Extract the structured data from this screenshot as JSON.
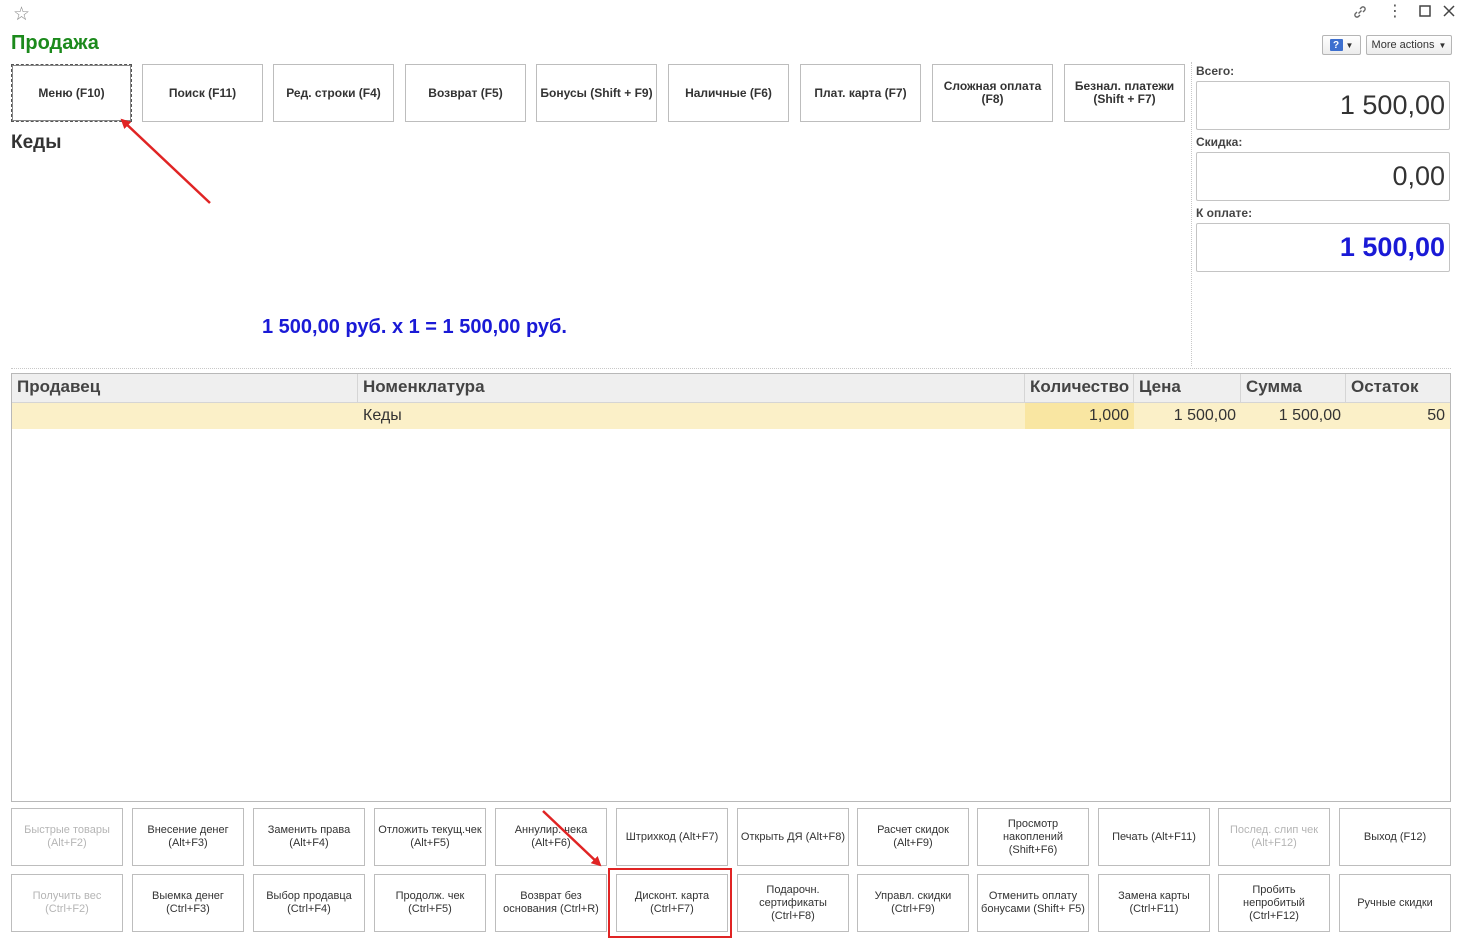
{
  "window": {
    "title": "Продажа",
    "controls": [
      "link-icon",
      "menu-icon",
      "maximize-icon",
      "close-icon"
    ]
  },
  "header_actions": {
    "help_label": "?",
    "more_actions": "More actions"
  },
  "top_buttons": [
    {
      "label": "Меню (F10)"
    },
    {
      "label": "Поиск (F11)"
    },
    {
      "label": "Ред. строки (F4)"
    },
    {
      "label": "Возврат (F5)"
    },
    {
      "label": "Бонусы (Shift + F9)"
    },
    {
      "label": "Наличные (F6)"
    },
    {
      "label": "Плат. карта (F7)"
    },
    {
      "label": "Сложная оплата (F8)"
    },
    {
      "label": "Безнал. платежи (Shift + F7)"
    }
  ],
  "current_item": {
    "name": "Кеды",
    "calculation": "1 500,00 руб. х 1  = 1 500,00 руб."
  },
  "totals": {
    "total_label": "Всего:",
    "total_value": "1 500,00",
    "discount_label": "Скидка:",
    "discount_value": "0,00",
    "to_pay_label": "К оплате:",
    "to_pay_value": "1 500,00"
  },
  "table": {
    "columns": [
      "Продавец",
      "Номенклатура",
      "Количество",
      "Цена",
      "Сумма",
      "Остаток"
    ],
    "rows": [
      {
        "seller": "",
        "item": "Кеды",
        "quantity": "1,000",
        "price": "1 500,00",
        "sum": "1 500,00",
        "stock": "50"
      }
    ]
  },
  "bottom_buttons_row1": [
    {
      "label": "Быстрые товары (Alt+F2)",
      "disabled": true
    },
    {
      "label": "Внесение денег (Alt+F3)",
      "disabled": false
    },
    {
      "label": "Заменить права (Alt+F4)",
      "disabled": false
    },
    {
      "label": "Отложить текущ.чек (Alt+F5)",
      "disabled": false
    },
    {
      "label": "Аннулир. чека (Alt+F6)",
      "disabled": false
    },
    {
      "label": "Штрихкод (Alt+F7)",
      "disabled": false
    },
    {
      "label": "Открыть ДЯ (Alt+F8)",
      "disabled": false
    },
    {
      "label": "Расчет скидок (Alt+F9)",
      "disabled": false
    },
    {
      "label": "Просмотр накоплений (Shift+F6)",
      "disabled": false
    },
    {
      "label": "Печать (Alt+F11)",
      "disabled": false
    },
    {
      "label": "Послед. слип чек (Alt+F12)",
      "disabled": true
    },
    {
      "label": "Выход (F12)",
      "disabled": false
    }
  ],
  "bottom_buttons_row2": [
    {
      "label": "Получить вес (Ctrl+F2)",
      "disabled": true
    },
    {
      "label": "Выемка денег (Ctrl+F3)",
      "disabled": false
    },
    {
      "label": "Выбор продавца (Ctrl+F4)",
      "disabled": false
    },
    {
      "label": "Продолж. чек (Ctrl+F5)",
      "disabled": false
    },
    {
      "label": "Возврат без основания (Ctrl+R)",
      "disabled": false
    },
    {
      "label": "Дисконт. карта (Ctrl+F7)",
      "disabled": false
    },
    {
      "label": "Подарочн. сертификаты (Ctrl+F8)",
      "disabled": false
    },
    {
      "label": "Управл. скидки (Ctrl+F9)",
      "disabled": false
    },
    {
      "label": "Отменить оплату бонусами (Shift+ F5)",
      "disabled": false
    },
    {
      "label": "Замена карты (Ctrl+F11)",
      "disabled": false
    },
    {
      "label": "Пробить непробитый (Ctrl+F12)",
      "disabled": false
    },
    {
      "label": "Ручные скидки",
      "disabled": false
    }
  ],
  "annotation_colors": {
    "arrow": "#e02424",
    "highlight": "#e02424"
  }
}
